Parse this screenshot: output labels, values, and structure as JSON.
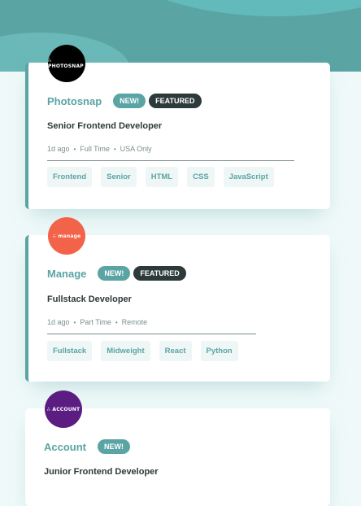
{
  "jobs": [
    {
      "company": "Photosnap",
      "logo_text": "∴ PHOTOSNAP",
      "logo_color": "#000000",
      "new_label": "NEW!",
      "featured_label": "FEATURED",
      "position": "Senior Frontend Developer",
      "posted": "1d ago",
      "contract": "Full Time",
      "location": "USA Only",
      "tags": [
        "Frontend",
        "Senior",
        "HTML",
        "CSS",
        "JavaScript"
      ]
    },
    {
      "company": "Manage",
      "logo_text": "∴ manage",
      "logo_color": "#f2634a",
      "new_label": "NEW!",
      "featured_label": "FEATURED",
      "position": "Fullstack Developer",
      "posted": "1d ago",
      "contract": "Part Time",
      "location": "Remote",
      "tags": [
        "Fullstack",
        "Midweight",
        "React",
        "Python"
      ]
    },
    {
      "company": "Account",
      "logo_text": "∴ ACCOUNT",
      "logo_color": "#5c1d83",
      "new_label": "NEW!",
      "position": "Junior Frontend Developer"
    }
  ],
  "colors": {
    "accent": "#5ba4a4",
    "dark": "#2c3a3a",
    "muted": "#7b8e8e",
    "background": "#eff9f9"
  }
}
